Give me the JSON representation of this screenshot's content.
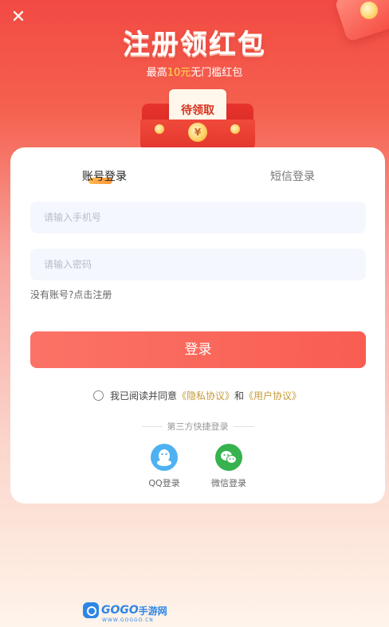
{
  "header": {
    "close_glyph": "✕",
    "title": "注册领红包",
    "subtitle_prefix": "最高",
    "subtitle_highlight": "10元",
    "subtitle_suffix": "无门槛红包",
    "envelope_label": "待领取",
    "coin_glyph": "¥"
  },
  "tabs": [
    {
      "label": "账号登录",
      "active": true
    },
    {
      "label": "短信登录",
      "active": false
    }
  ],
  "form": {
    "phone_placeholder": "请输入手机号",
    "password_placeholder": "请输入密码",
    "register_link": "没有账号?点击注册",
    "login_button": "登录"
  },
  "agreement": {
    "prefix": "我已阅读并同意",
    "privacy": "《隐私协议》",
    "and": "和",
    "user": "《用户协议》",
    "checked": false
  },
  "third_party": {
    "title": "第三方快捷登录",
    "options": [
      {
        "label": "QQ登录",
        "icon": "qq-icon"
      },
      {
        "label": "微信登录",
        "icon": "wechat-icon"
      }
    ]
  },
  "watermark": {
    "brand": "GOGO",
    "suffix": "手游网",
    "url": "WWW.GOGGO.CN"
  },
  "colors": {
    "primary": "#f95d52",
    "accent": "#ffe04a",
    "link": "#c69a3a",
    "qq": "#4eb1f2",
    "wechat": "#36b24f"
  }
}
